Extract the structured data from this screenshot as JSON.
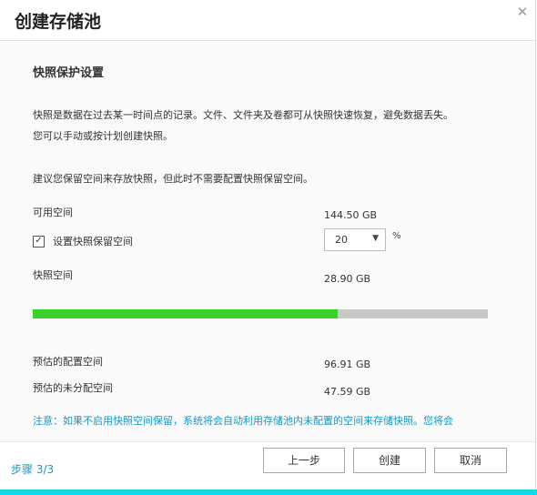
{
  "dialog": {
    "title": "创建存储池",
    "close_icon": "close-icon"
  },
  "section": {
    "title": "快照保护设置",
    "intro_line1": "快照是数据在过去某一时间点的记录。文件、文件夹及卷都可从快照快速恢复，避免数据丢失。",
    "intro_line2": "您可以手动或按计划创建快照。",
    "suggestion": "建议您保留空间来存放快照，但此时不需要配置快照保留空间。"
  },
  "fields": {
    "available_label": "可用空间",
    "available_value": "144.50 GB",
    "reserve_checkbox_label": "设置快照保留空间",
    "reserve_checked": true,
    "reserve_percent": "20",
    "percent_unit": "%",
    "snapshot_label": "快照空间",
    "snapshot_value": "28.90 GB",
    "usage_fill_fraction": 0.67,
    "estimated_configured_label": "预估的配置空间",
    "estimated_configured_value": "96.91 GB",
    "estimated_unallocated_label": "预估的未分配空间",
    "estimated_unallocated_value": "47.59 GB"
  },
  "note": "注意：如果不启用快照空间保留，系统将会自动利用存储池内未配置的空间来存储快照。您将会",
  "footer": {
    "step": "步骤 3/3",
    "prev_label": "上一步",
    "create_label": "创建",
    "cancel_label": "取消"
  },
  "colors": {
    "accent": "#1797c7",
    "progress_fill": "#3ad12a",
    "progress_track": "#c8c8c8",
    "bottom_bar": "#12d9e8"
  }
}
